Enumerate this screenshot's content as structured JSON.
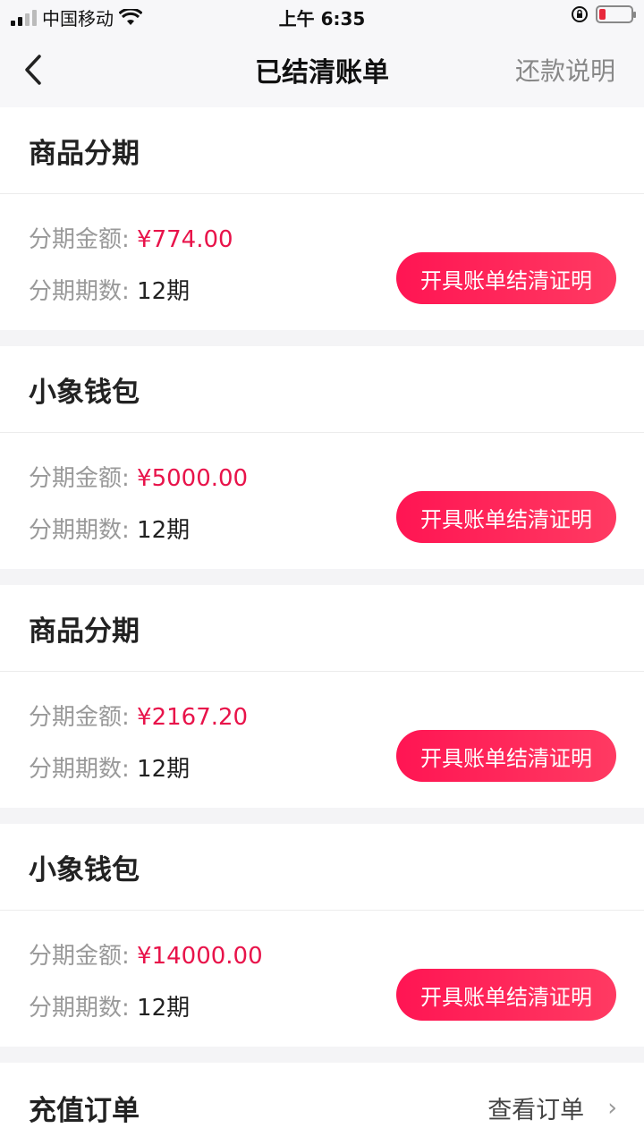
{
  "status_bar": {
    "carrier": "中国移动",
    "time": "上午 6:35",
    "battery_level": 0.18,
    "battery_color": "#e8283b"
  },
  "nav": {
    "title": "已结清账单",
    "right_link": "还款说明",
    "back_icon": "chevron-left-icon"
  },
  "cards": [
    {
      "title": "商品分期",
      "amount_label": "分期金额:",
      "amount": "¥774.00",
      "periods_label": "分期期数:",
      "periods": "12期",
      "button": "开具账单结清证明"
    },
    {
      "title": "小象钱包",
      "amount_label": "分期金额:",
      "amount": "¥5000.00",
      "periods_label": "分期期数:",
      "periods": "12期",
      "button": "开具账单结清证明"
    },
    {
      "title": "商品分期",
      "amount_label": "分期金额:",
      "amount": "¥2167.20",
      "periods_label": "分期期数:",
      "periods": "12期",
      "button": "开具账单结清证明"
    },
    {
      "title": "小象钱包",
      "amount_label": "分期金额:",
      "amount": "¥14000.00",
      "periods_label": "分期期数:",
      "periods": "12期",
      "button": "开具账单结清证明"
    }
  ],
  "order": {
    "title": "充值订单",
    "link": "查看订单",
    "chevron": "›"
  },
  "colors": {
    "accent": "#ff1553",
    "amount": "#e8134a",
    "background": "#f4f4f6"
  }
}
